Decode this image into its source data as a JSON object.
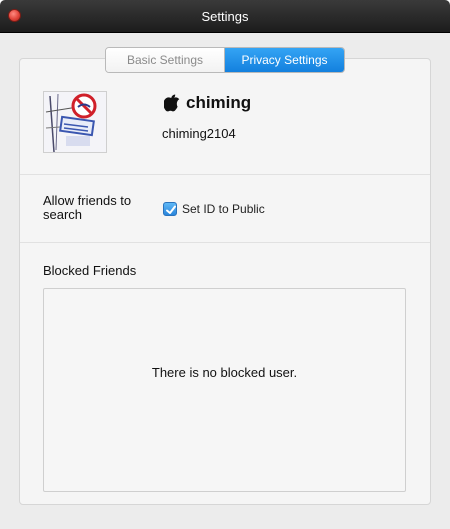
{
  "window": {
    "title": "Settings"
  },
  "tabs": [
    {
      "label": "Basic Settings",
      "active": false
    },
    {
      "label": "Privacy Settings",
      "active": true
    }
  ],
  "profile": {
    "nickname": "chiming",
    "user_id": "chiming2104",
    "platform_icon": "apple-icon"
  },
  "search": {
    "label": "Allow friends to search",
    "checkbox_label": "Set ID to Public",
    "checked": true
  },
  "blocked": {
    "title": "Blocked Friends",
    "empty_message": "There is no blocked user."
  },
  "colors": {
    "accent": "#1a8ae6",
    "titlebar": "#262626",
    "close": "#e0443a"
  }
}
